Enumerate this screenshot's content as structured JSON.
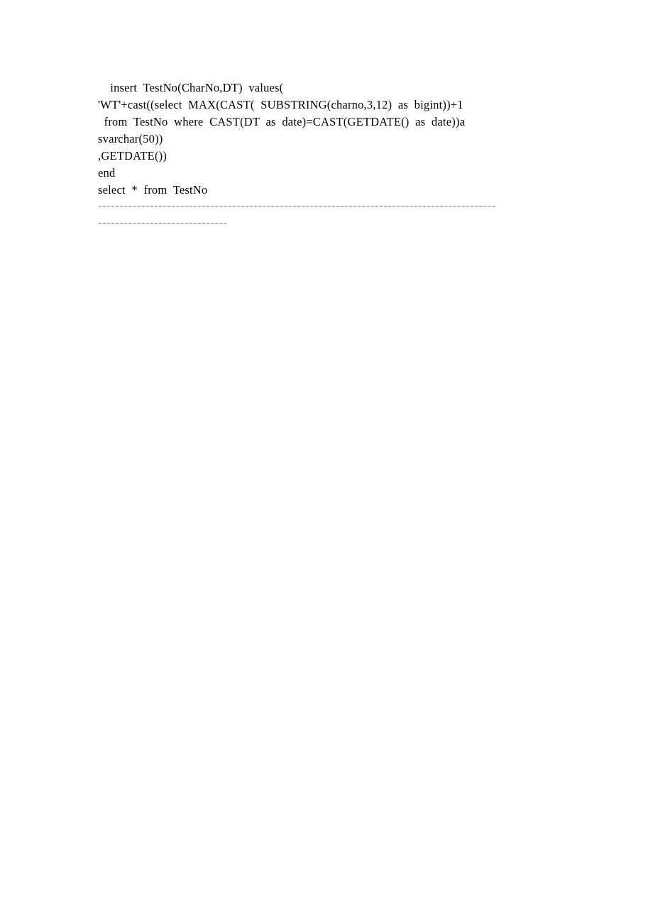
{
  "document": {
    "background_color": "#ffffff",
    "text_color": "#000000",
    "separator_color": "#8c8c8c",
    "code": {
      "language": "sql",
      "lines": [
        "    insert  TestNo(CharNo,DT)  values(",
        "'WT'+cast((select  MAX(CAST(  SUBSTRING(charno,3,12)  as  bigint))+1",
        "  from  TestNo  where  CAST(DT  as  date)=CAST(GETDATE()  as  date))a",
        "svarchar(50))",
        ",GETDATE())",
        "end",
        "select  *  from  TestNo"
      ]
    },
    "separators": [
      {
        "id": "separator-top",
        "text": "--------------------------------------------------------------------------------------------"
      },
      {
        "id": "separator-bottom",
        "text": "------------------------------"
      }
    ]
  }
}
